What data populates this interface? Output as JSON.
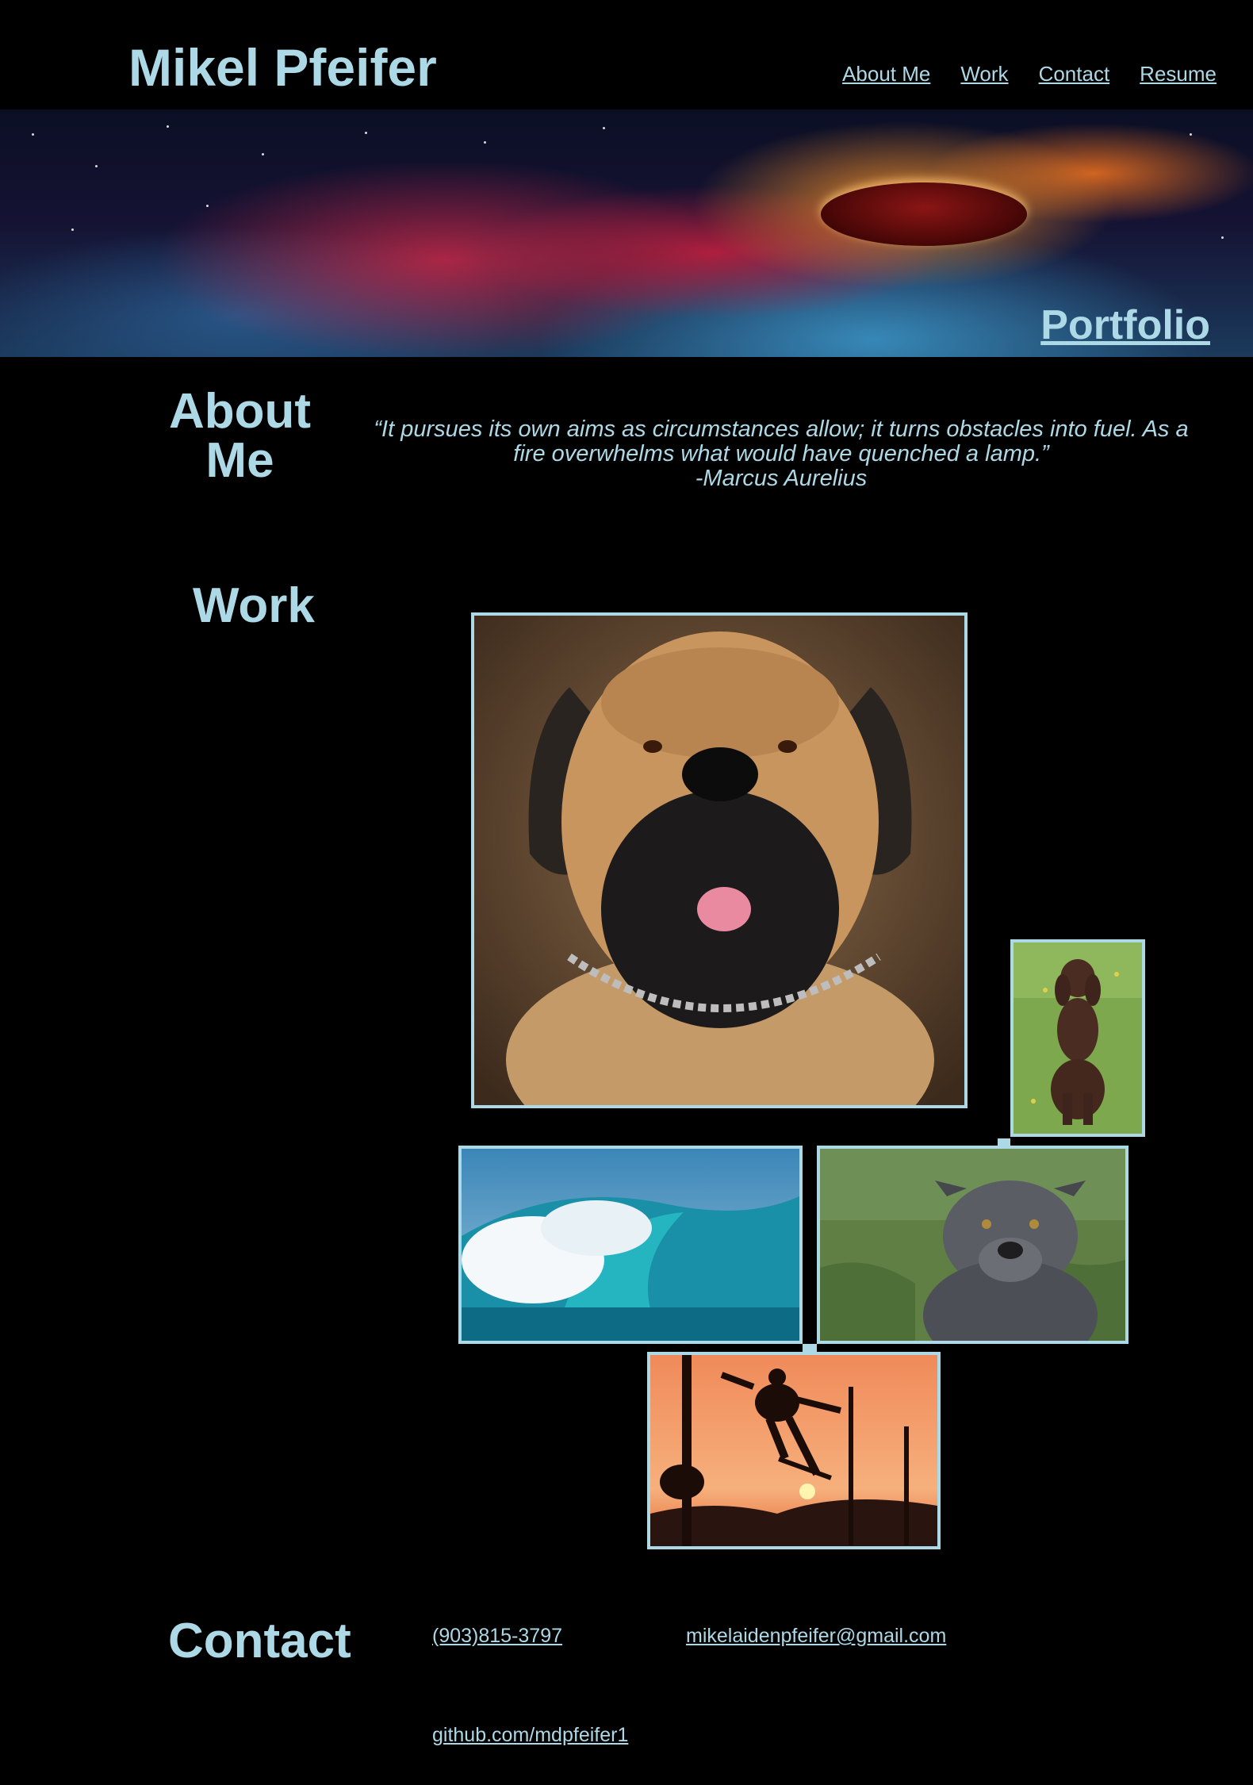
{
  "header": {
    "site_name": "Mikel Pfeifer",
    "nav": [
      {
        "label": "About Me"
      },
      {
        "label": "Work"
      },
      {
        "label": "Contact"
      },
      {
        "label": "Resume"
      }
    ]
  },
  "hero": {
    "title": "Portfolio"
  },
  "about": {
    "heading": "About Me",
    "quote_line1": "“It pursues its own aims as circumstances allow; it turns obstacles into fuel. As a",
    "quote_line2": "fire overwhelms what would have quenched a lamp.”",
    "quote_author": "-Marcus Aurelius"
  },
  "work": {
    "heading": "Work",
    "accent_color": "#add8e6"
  },
  "contact": {
    "heading": "Contact",
    "phone": "(903)815-3797",
    "email": "mikelaidenpfeifer@gmail.com",
    "github": "github.com/mdpfeifer1"
  }
}
